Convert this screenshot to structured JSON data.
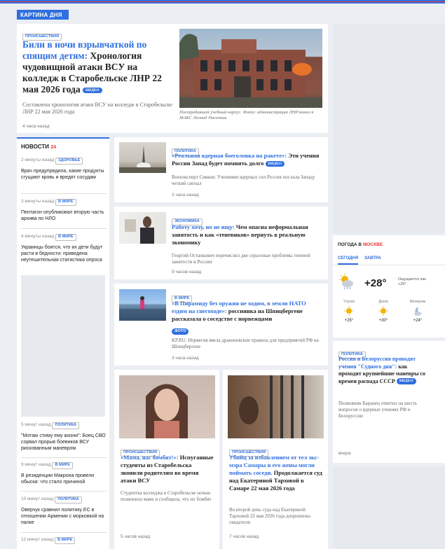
{
  "header": {
    "label": "КАРТИНА ДНЯ"
  },
  "main_story": {
    "tag": "ПРОИСШЕСТВИЯ",
    "title_blue": "Били в ночи взрывчаткой по спящим детям:",
    "title_rest": " Хронология чудовищной атаки ВСУ на колледж в Старобельске ЛНР 22 мая 2026 года",
    "badge": "ВИДЕО",
    "subtitle": "Составлена хронология атаки ВСУ на колледж в Старобельске ЛНР 22 мая 2026 года",
    "time": "4 часа назад",
    "caption": "Пострадавший учебный корпус. Фото: администрация ЛНР/канал в МАКС Леонид Пасечник"
  },
  "news_sidebar": {
    "title": "НОВОСТИ",
    "count": "24",
    "items": [
      {
        "time": "2 минуты назад",
        "tag": "ЗДОРОВЬЕ",
        "text": "Врач предупредила, какие продукты сгущают кровь и вредят сосудам"
      },
      {
        "time": "3 минуты назад",
        "tag": "В МИРЕ",
        "text": "Пентагон опубликовал вторую часть архива по НЛО"
      },
      {
        "time": "4 минуты назад",
        "tag": "В МИРЕ",
        "text": "Украинцы боятся, что их дети будут расти в бедности: приведена неутешительная статистика опроса"
      },
      {
        "time": "5 минут назад",
        "tag": "ПОЛИТИКА",
        "text": "\"Мотаю стиму ему жизни\": Боец СВО сорвал прорыв боевиков ВСУ рискованным маневром"
      },
      {
        "time": "9 минут назад",
        "tag": "В МИРЕ",
        "text": "В резиденции Макрона провели обыски: что стало причиной"
      },
      {
        "time": "10 минут назад",
        "tag": "ПОЛИТИКА",
        "text": "Оверчук сравнил политику ЕС в отношении Армении с морковкой на палке"
      },
      {
        "time": "12 минут назад",
        "tag": "В МИРЕ",
        "text": ""
      }
    ]
  },
  "articles": [
    {
      "tag": "ПОЛИТИКА",
      "title_blue": "«Реальная ядерная боеголовка на ракете»:",
      "title_rest": " Эти учения России Запад будет помнить долго",
      "badge": "ВИДЕО",
      "subtitle": "Военэксперт Сивков: Учениями ядерных сил Россия послала Западу четкий сигнал",
      "time": "2 часа назад"
    },
    {
      "tag": "ЭКОНОМИКА",
      "title_blue": "Работу хочу, но не ищу:",
      "title_rest": " Чем опасна неформальная занятость и как «теневиков» вернуть в реальную экономику",
      "badge": "",
      "subtitle": "Георгий Остапкович перечислил две серьезные проблемы теневой занятости в России",
      "time": "9 часов назад"
    },
    {
      "tag": "В МИРЕ",
      "title_blue": "«В Пирамиду без оружия не ходим, в земли НАТО ездим на снегоходе»:",
      "title_rest": " россиянка на Шпицбергене рассказала о соседстве с норвежцами",
      "badge": "ФОТО",
      "subtitle": "KP.RU: Норвегия ввела драконовские правила для предприятий РФ на Шпицбергене",
      "time": "3 часа назад"
    }
  ],
  "bottom_cards": [
    {
      "tag": "ПРОИСШЕСТВИЯ",
      "title_blue": "«Мама, нас бомбят!»:",
      "title_rest": " Испуганные студенты из Старобельска звонили родителям во время атаки ВСУ",
      "subtitle": "Студентка колледжа в Старобельске ночью позвонила маме и сообщила, что их бомбят",
      "time": "5 часов назад"
    },
    {
      "tag": "ПРОИСШЕСТВИЯ",
      "title_blue": "Убийц за избавлением от тел экс-мэра Самары и его жены могли поймать соседи.",
      "title_rest": " Продолжается суд над Екатериной Тарховой в Самаре 22 мая 2026 года",
      "subtitle": "Во второй день суда над Екатериной Тарховой 22 мая 2026 года допрошены свидетели",
      "time": "7 часов назад"
    }
  ],
  "weather": {
    "title_prefix": "ПОГОДА В",
    "city": "МОСКВЕ",
    "tab_today": "СЕГОДНЯ",
    "tab_tomorrow": "ЗАВТРА",
    "temp": "+28°",
    "feels": "Ощущается как +29°",
    "periods": [
      {
        "label": "Утром",
        "temp": "+25°"
      },
      {
        "label": "Днем",
        "temp": "+30°"
      },
      {
        "label": "Вечером",
        "temp": "+24°"
      }
    ]
  },
  "right_story": {
    "tag": "ПОЛИТИКА",
    "title_blue": "Россия и Белоруссия проводят учения \"Судного дня\":",
    "title_rest": " как проходят крупнейшие маневры со времен распада СССР",
    "badge": "ВИДЕО",
    "subtitle": "Полковник Баранец ответил на шесть вопросов о ядерных учениях РФ и Белоруссии",
    "time": "вчера"
  },
  "colors": {
    "accent": "#2f6fe0",
    "red": "#e33"
  }
}
